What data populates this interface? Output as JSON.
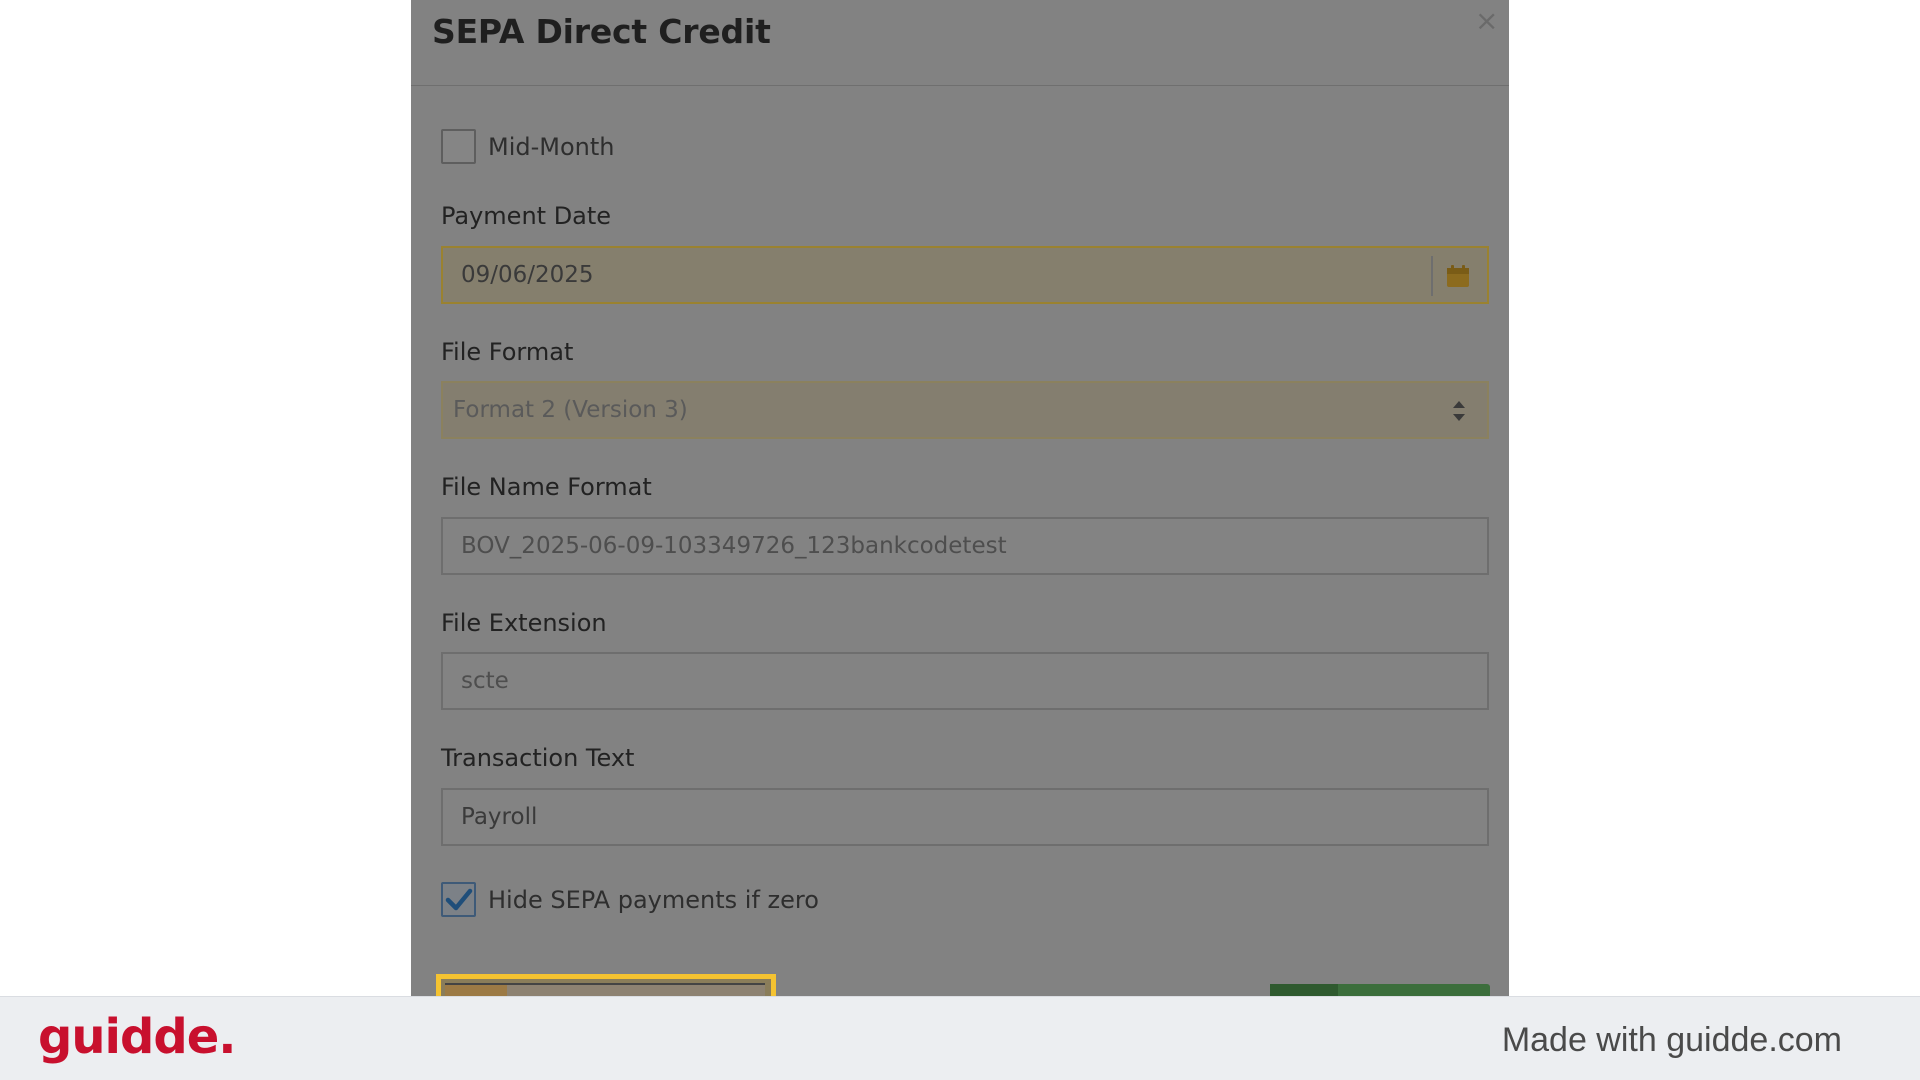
{
  "modal": {
    "title": "SEPA Direct Credit",
    "close_glyph": "×",
    "mid_month": {
      "label": "Mid-Month",
      "checked": false
    },
    "payment_date": {
      "label": "Payment Date",
      "value": "09/06/2025",
      "icon": "calendar-icon"
    },
    "file_format": {
      "label": "File Format",
      "value": "Format 2 (Version 3)",
      "icon": "sort-arrows-icon"
    },
    "file_name_format": {
      "label": "File Name Format",
      "value": "BOV_2025-06-09-103349726_123bankcodetest"
    },
    "file_extension": {
      "label": "File Extension",
      "value": "scte"
    },
    "transaction_text": {
      "label": "Transaction Text",
      "value": "Payroll"
    },
    "hide_zero": {
      "label": "Hide SEPA payments if zero",
      "checked": true
    }
  },
  "footer": {
    "brand": "guidde.",
    "made_with": "Made with guidde.com"
  },
  "colors": {
    "highlight": "#f5c331",
    "brand": "#c8102e",
    "primary_button": "#3c6e3c"
  }
}
